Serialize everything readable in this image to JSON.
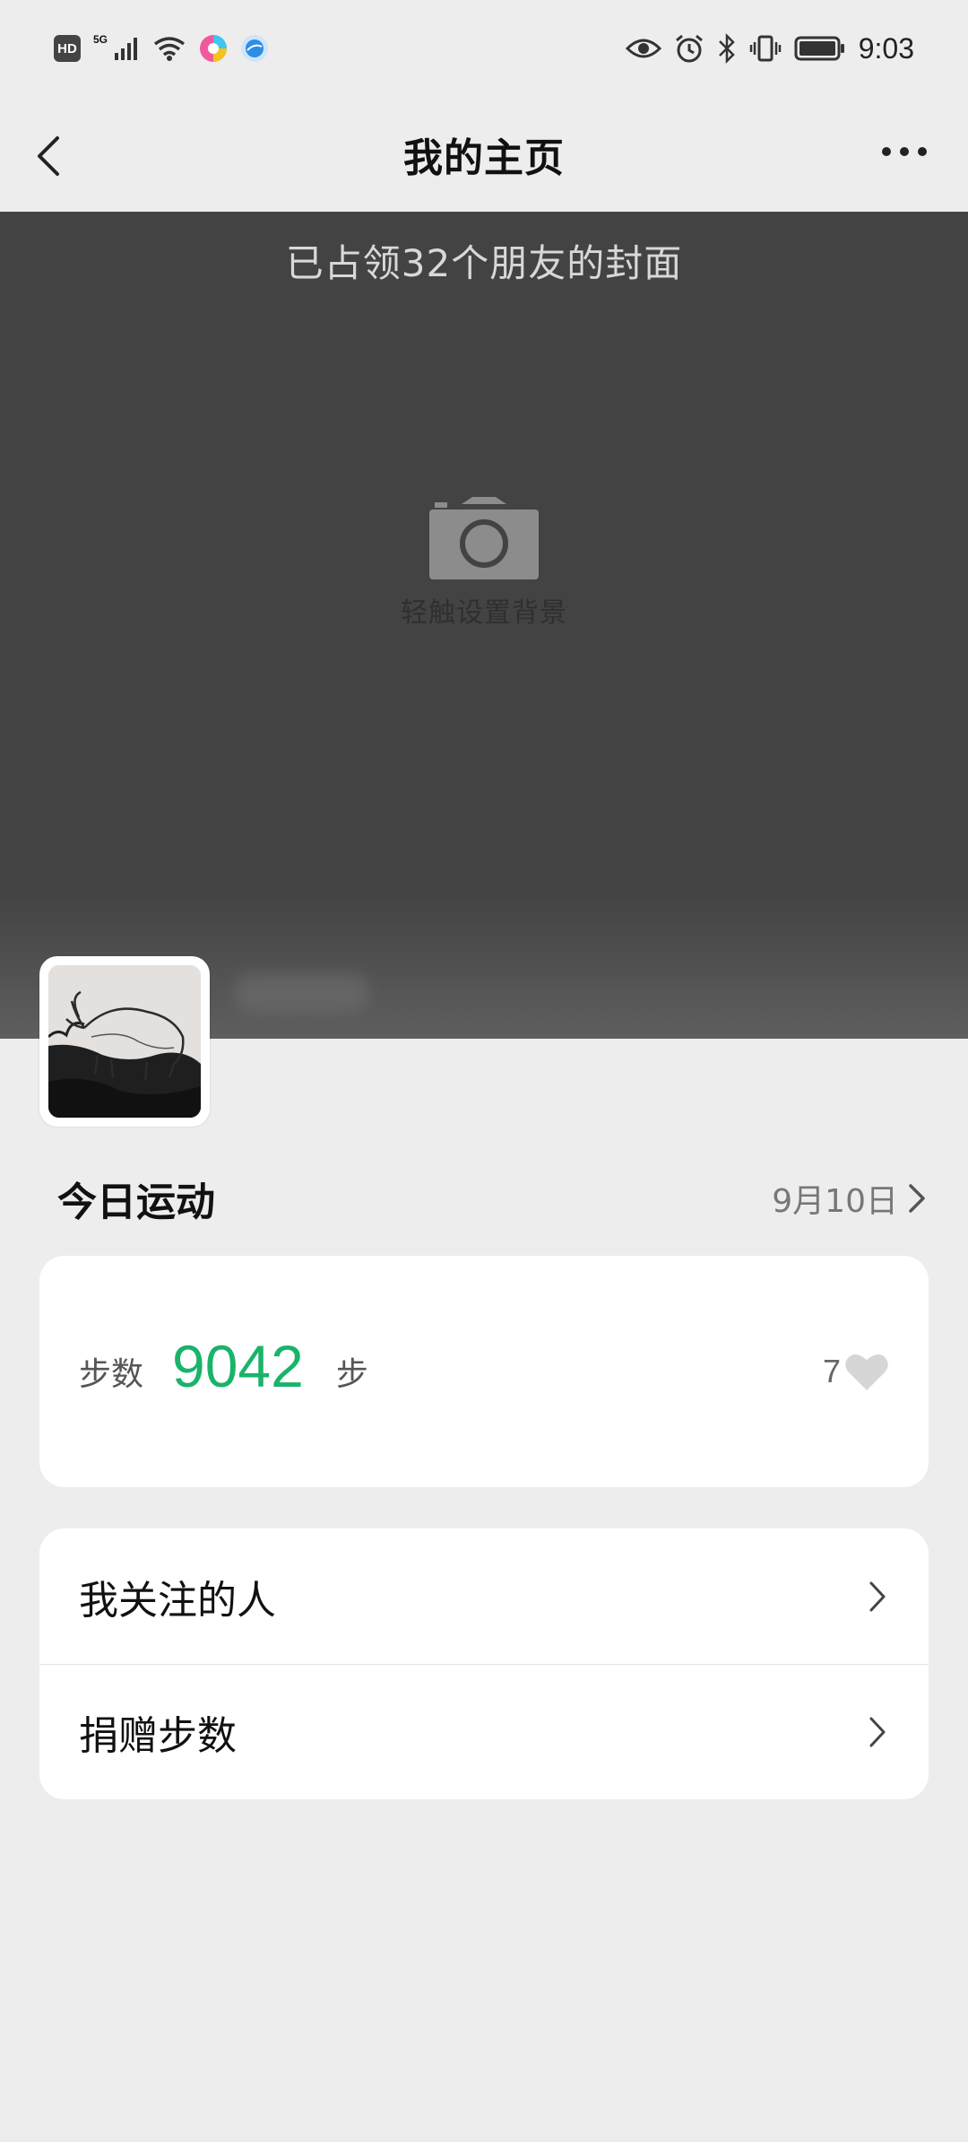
{
  "status_bar": {
    "hd": "HD",
    "network": "5G",
    "time": "9:03"
  },
  "nav": {
    "title": "我的主页"
  },
  "cover": {
    "caption": "已占领32个朋友的封面",
    "set_background_hint": "轻触设置背景"
  },
  "today": {
    "title": "今日运动",
    "date": "9月10日"
  },
  "steps": {
    "label": "步数",
    "value": "9042",
    "unit": "步",
    "likes": "7"
  },
  "menu": {
    "items": [
      {
        "label": "我关注的人"
      },
      {
        "label": "捐赠步数"
      }
    ]
  },
  "colors": {
    "accent_green": "#1ab36a",
    "page_bg": "#ededed",
    "cover_bg": "#434343"
  }
}
